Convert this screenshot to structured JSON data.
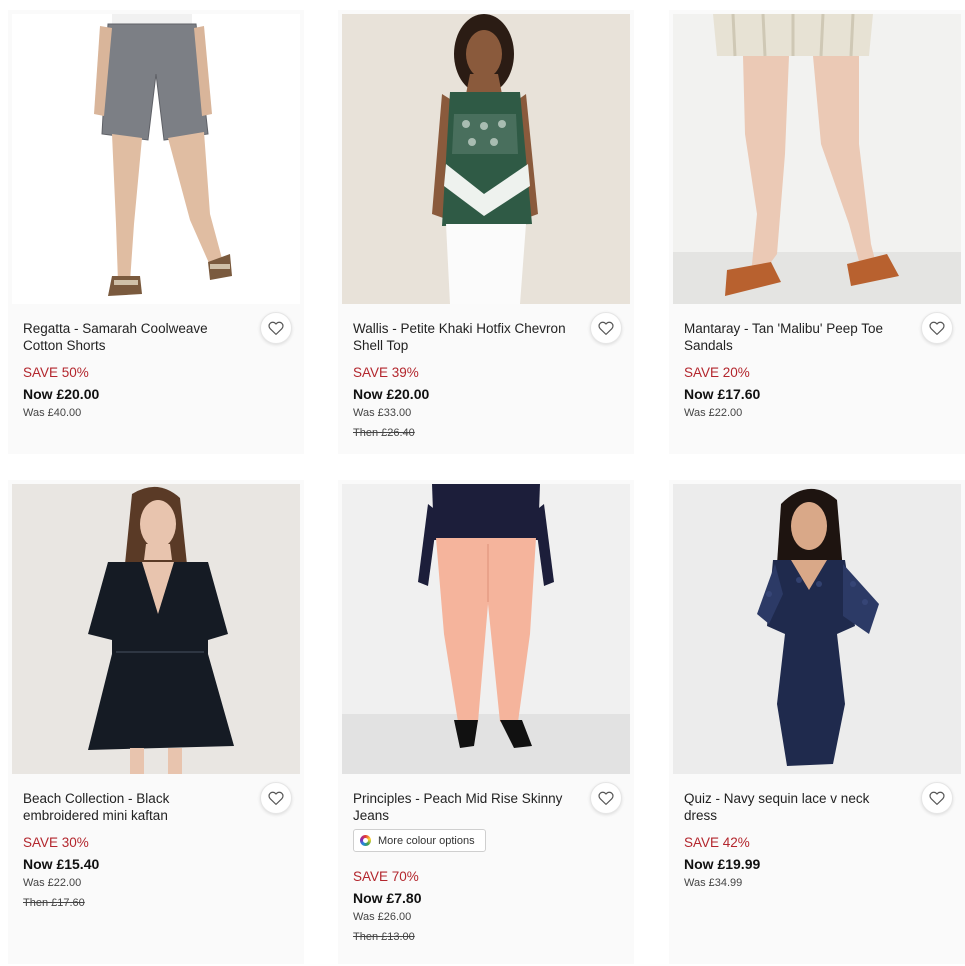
{
  "products": [
    {
      "title": "Regatta - Samarah Coolweave Cotton Shorts",
      "save": "SAVE 50%",
      "now": "Now £20.00",
      "was": "Was £40.00",
      "then": ""
    },
    {
      "title": "Wallis - Petite Khaki Hotfix Chevron Shell Top",
      "save": "SAVE 39%",
      "now": "Now £20.00",
      "was": "Was £33.00",
      "then": "Then £26.40"
    },
    {
      "title": "Mantaray - Tan 'Malibu' Peep Toe Sandals",
      "save": "SAVE 20%",
      "now": "Now £17.60",
      "was": "Was £22.00",
      "then": ""
    },
    {
      "title": "Beach Collection - Black embroidered mini kaftan",
      "save": "SAVE 30%",
      "now": "Now £15.40",
      "was": "Was £22.00",
      "then": "Then £17.60"
    },
    {
      "title": "Principles - Peach Mid Rise Skinny Jeans",
      "colour_options": "More colour options",
      "save": "SAVE 70%",
      "now": "Now £7.80",
      "was": "Was £26.00",
      "then": "Then £13.00"
    },
    {
      "title": "Quiz - Navy sequin lace v neck dress",
      "save": "SAVE 42%",
      "now": "Now £19.99",
      "was": "Was £34.99",
      "then": ""
    }
  ],
  "colors": {
    "save_red": "#b3262d",
    "card_bg": "#fafafa"
  },
  "icons": {
    "wishlist": "heart-outline-icon",
    "colour_options": "colour-wheel-icon"
  }
}
